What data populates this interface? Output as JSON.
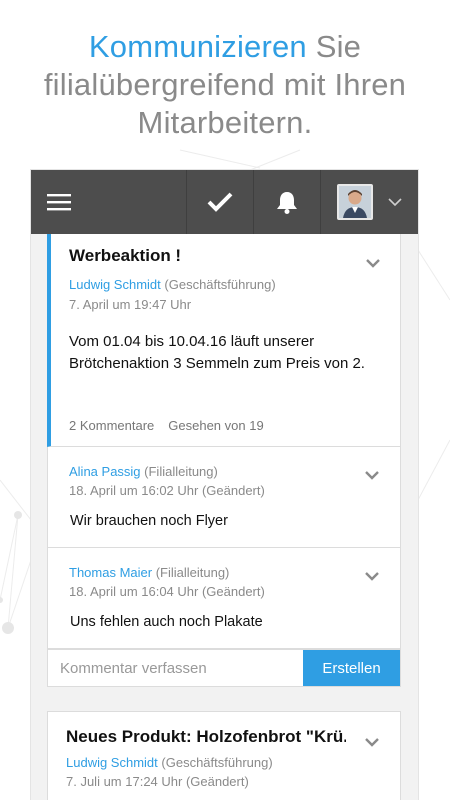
{
  "headline": {
    "accent": "Kommunizieren",
    "rest": " Sie filialübergreifend mit Ihren Mitarbeitern."
  },
  "topbar": {
    "menu_icon": "hamburger-icon",
    "check_icon": "checkmark-icon",
    "bell_icon": "bell-icon",
    "dropdown_icon": "chevron-down-icon",
    "background": "#4d4d4d"
  },
  "posts": [
    {
      "title": "Werbeaktion !",
      "author": "Ludwig Schmidt",
      "role": " (Geschäftsführung)",
      "date": "7. April um 19:47 Uhr",
      "body": "Vom 01.04 bis 10.04.16 läuft unserer Brötchenaktion 3 Semmeln zum Preis von 2.",
      "comments_label": "2 Kommentare",
      "seen_label": "Gesehen von 19"
    },
    {
      "title": "Neues Produkt: Holzofenbrot \"Krü...",
      "author": "Ludwig Schmidt",
      "role": " (Geschäftsführung)",
      "date": "7. Juli um 17:24 Uhr (Geändert)"
    }
  ],
  "comments": [
    {
      "author": "Alina Passig",
      "role": " (Filialleitung)",
      "date": "18. April um 16:02 Uhr (Geändert)",
      "text": "Wir brauchen noch Flyer"
    },
    {
      "author": "Thomas Maier",
      "role": " (Filialleitung)",
      "date": "18. April um 16:04 Uhr (Geändert)",
      "text": "Uns fehlen auch noch Plakate"
    }
  ],
  "compose": {
    "placeholder": "Kommentar verfassen",
    "submit_label": "Erstellen"
  },
  "colors": {
    "accent": "#2f9ee3",
    "topbar": "#4d4d4d"
  }
}
